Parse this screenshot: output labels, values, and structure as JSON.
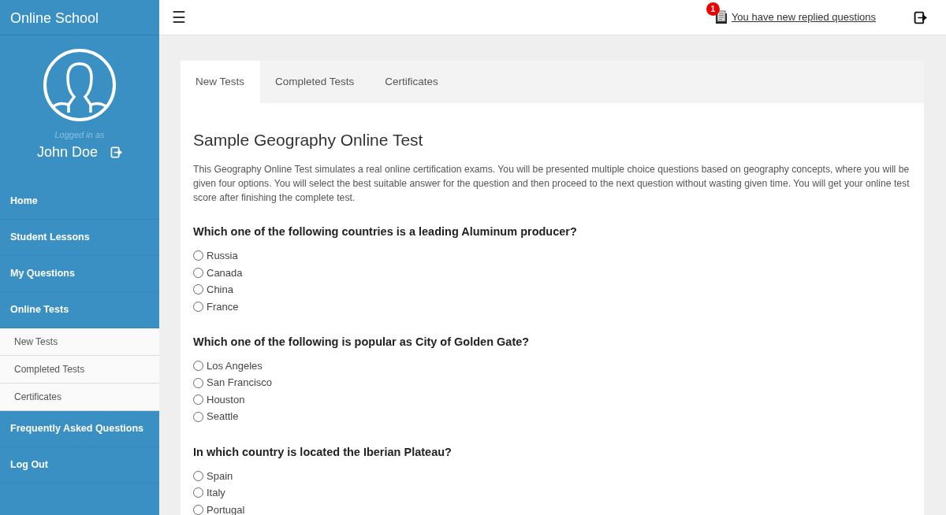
{
  "sidebar": {
    "brand": "Online School",
    "logged_in_label": "Logged in as",
    "user_name": "John Doe",
    "items": [
      {
        "label": "Home"
      },
      {
        "label": "Student Lessons"
      },
      {
        "label": "My Questions"
      },
      {
        "label": "Online Tests",
        "children": [
          {
            "label": "New Tests"
          },
          {
            "label": "Completed Tests"
          },
          {
            "label": "Certificates"
          }
        ]
      },
      {
        "label": "Frequently Asked Questions"
      },
      {
        "label": "Log Out"
      }
    ]
  },
  "topbar": {
    "menu_glyph": "☰",
    "notification_count": "1",
    "notification_link": "You have new replied questions"
  },
  "tabs": [
    {
      "label": "New Tests",
      "selected": true
    },
    {
      "label": "Completed Tests",
      "selected": false
    },
    {
      "label": "Certificates",
      "selected": false
    }
  ],
  "test": {
    "title": "Sample Geography Online Test",
    "description": "This Geography Online Test simulates a real online certification exams. You will be presented multiple choice questions based on geography concepts, where you will be given four options. You will select the best suitable answer for the question and then proceed to the next question without wasting given time. You will get your online test score after finishing the complete test.",
    "questions": [
      {
        "text": "Which one of the following countries is a leading Aluminum producer?",
        "options": [
          {
            "label": "Russia",
            "selected": false
          },
          {
            "label": "Canada",
            "selected": false
          },
          {
            "label": "China",
            "selected": false
          },
          {
            "label": "France",
            "selected": false
          }
        ]
      },
      {
        "text": "Which one of the following is popular as City of Golden Gate?",
        "options": [
          {
            "label": "Los Angeles",
            "selected": false
          },
          {
            "label": "San Francisco",
            "selected": false
          },
          {
            "label": "Houston",
            "selected": false
          },
          {
            "label": "Seattle",
            "selected": false
          }
        ]
      },
      {
        "text": "In which country is located the Iberian Plateau?",
        "options": [
          {
            "label": "Spain",
            "selected": false
          },
          {
            "label": "Italy",
            "selected": false
          },
          {
            "label": "Portugal",
            "selected": false
          }
        ]
      }
    ]
  }
}
